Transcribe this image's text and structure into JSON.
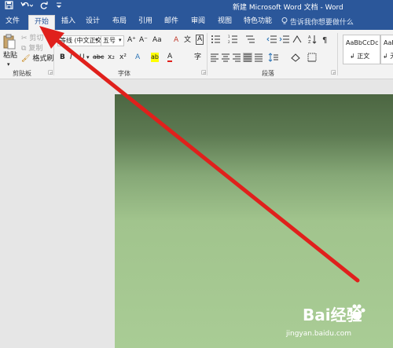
{
  "window": {
    "title": "新建 Microsoft Word 文档 - Word"
  },
  "quick_access": {
    "save_icon": "save-icon",
    "undo_icon": "undo-icon",
    "redo_icon": "redo-icon",
    "customize_icon": "customize-qat-icon"
  },
  "tabs": [
    "文件",
    "开始",
    "插入",
    "设计",
    "布局",
    "引用",
    "邮件",
    "审阅",
    "视图",
    "特色功能"
  ],
  "active_tab": "开始",
  "tell_me": {
    "text": "告诉我你想要做什么",
    "icon": "lightbulb-icon"
  },
  "clipboard": {
    "paste": "粘贴",
    "cut": "剪切",
    "copy": "复制",
    "format_painter": "格式刷",
    "group_label": "剪贴板"
  },
  "font": {
    "font_name": "等线 (中文正文)",
    "font_size": "五号",
    "group_label": "字体",
    "bold": "B",
    "italic": "I",
    "underline": "U",
    "strike": "abc",
    "subscript": "x₂",
    "superscript": "x²",
    "grow": "A⁺",
    "shrink": "A⁻",
    "change_case": "Aa",
    "clear": "A",
    "text_effect": "A",
    "highlight": "ab",
    "font_color": "A",
    "phonetic": "文",
    "border": "A",
    "circle": "字"
  },
  "paragraph": {
    "group_label": "段落"
  },
  "styles": {
    "normal": "AaBbCcDc",
    "normal_label": "正文",
    "no_spacing": "AaBbC",
    "no_spacing_label": "无"
  },
  "watermark": {
    "brand": "Bai经验",
    "url": "jingyan.baidu.com"
  },
  "colors": {
    "accent": "#2b579a",
    "arrow": "#e0201c",
    "highlight": "#ffff00",
    "font_color": "#e0201c"
  }
}
